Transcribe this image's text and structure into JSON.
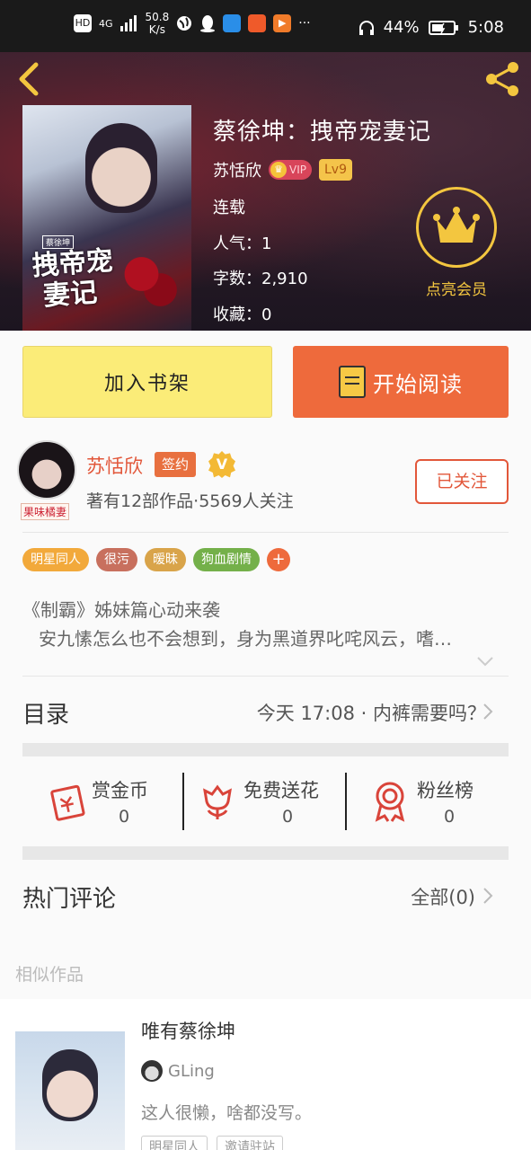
{
  "status_bar": {
    "network_hd": "HD",
    "network_4g": "4G",
    "net_speed_value": "50.8",
    "net_speed_unit": "K/s",
    "battery": "44%",
    "time": "5:08",
    "more": "···"
  },
  "book": {
    "title": "蔡徐坤：拽帝宠妻记",
    "author": "苏恬欣",
    "vip_label": "VIP",
    "level": "Lv9",
    "status": "连载",
    "popularity": "人气：1",
    "word_count": "字数：2,910",
    "favorites": "收藏：0",
    "cover_tag": "蔡徐坤",
    "cover_title_line1": "拽帝宠",
    "cover_title_line2": "妻记",
    "member_cta": "点亮会员"
  },
  "actions": {
    "add_to_shelf": "加入书架",
    "start_reading": "开始阅读"
  },
  "author_card": {
    "name": "苏恬欣",
    "signed_badge": "签约",
    "v_badge": "V",
    "avatar_tag": "果味橘妻",
    "stats": "著有12部作品·5569人关注",
    "follow_label": "已关注"
  },
  "tags": [
    {
      "label": "明星同人",
      "color": "#f2a93b"
    },
    {
      "label": "很污",
      "color": "#c8705e"
    },
    {
      "label": "暧昧",
      "color": "#d9a44a"
    },
    {
      "label": "狗血剧情",
      "color": "#74b04a"
    }
  ],
  "tag_more": "+",
  "synopsis": {
    "line1": "《制霸》姊妹篇心动来袭",
    "line2": "安九愫怎么也不会想到，身为黑道界叱咤风云，嗜…"
  },
  "catalog": {
    "label": "目录",
    "latest": "今天 17:08 · 内裤需要吗？"
  },
  "stats": [
    {
      "label": "赏金币",
      "value": "0",
      "icon": "red-envelope-icon"
    },
    {
      "label": "免费送花",
      "value": "0",
      "icon": "flower-icon"
    },
    {
      "label": "粉丝榜",
      "value": "0",
      "icon": "medal-icon"
    }
  ],
  "comments": {
    "label": "热门评论",
    "all": "全部(0)"
  },
  "similar": {
    "label": "相似作品",
    "items": [
      {
        "title": "唯有蔡徐坤",
        "author": "GLing",
        "description": "这人很懒，啥都没写。",
        "tags": [
          "明星同人",
          "邀请驻站"
        ]
      }
    ]
  },
  "colors": {
    "accent_orange": "#ee6a3c",
    "shelf_yellow": "#fbec78",
    "vip_gold": "#f3c63f",
    "author_red": "#e2573a"
  }
}
